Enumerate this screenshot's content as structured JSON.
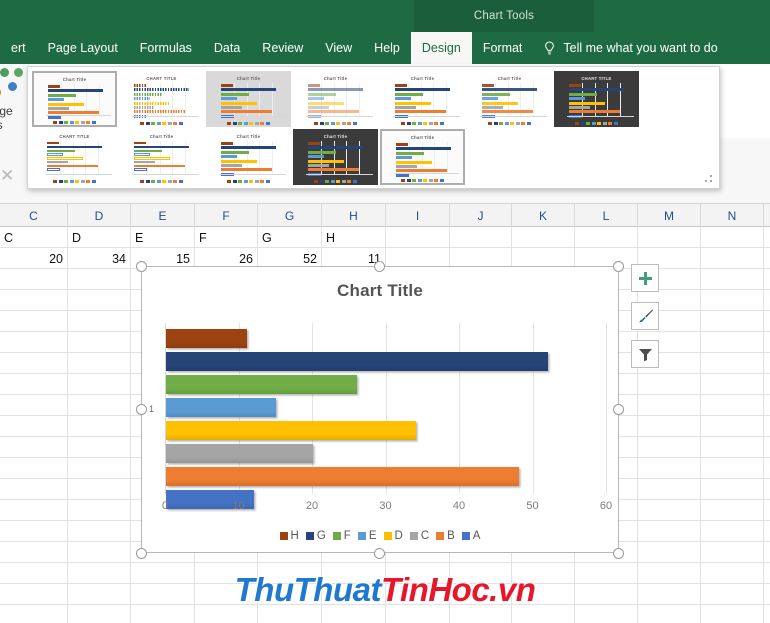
{
  "ribbon": {
    "contextual_title": "Chart Tools",
    "tabs": [
      {
        "label": "ert",
        "active": false
      },
      {
        "label": "Page Layout",
        "active": false
      },
      {
        "label": "Formulas",
        "active": false
      },
      {
        "label": "Data",
        "active": false
      },
      {
        "label": "Review",
        "active": false
      },
      {
        "label": "View",
        "active": false
      },
      {
        "label": "Help",
        "active": false
      },
      {
        "label": "Design",
        "active": true
      },
      {
        "label": "Format",
        "active": false
      }
    ],
    "tell_me": "Tell me what you want to do",
    "tell_me_icon": "lightbulb-icon",
    "change_colors_label_line1": "ange",
    "change_colors_label_line2": "ors",
    "change_colors_icon": "color-dots-icon"
  },
  "gallery": {
    "name": "chart-styles-gallery",
    "resize_grip_icon": "resize-grip-icon",
    "thumbnails": [
      {
        "title": "Chart Title",
        "selected": true,
        "variant": "plain"
      },
      {
        "title": "CHART TITLE",
        "selected": false,
        "variant": "dotted"
      },
      {
        "title": "Chart Title",
        "selected": false,
        "variant": "gray"
      },
      {
        "title": "Chart Title",
        "selected": false,
        "variant": "pastel"
      },
      {
        "title": "Chart Title",
        "selected": false,
        "variant": "plain"
      },
      {
        "title": "Chart Title",
        "selected": false,
        "variant": "hatched"
      },
      {
        "title": "CHART TITLE",
        "selected": false,
        "variant": "dark"
      },
      {
        "title": "CHART TITLE",
        "selected": false,
        "variant": "outline"
      },
      {
        "title": "Chart Title",
        "selected": false,
        "variant": "outline2"
      },
      {
        "title": "Chart Title",
        "selected": false,
        "variant": "plain"
      },
      {
        "title": "Chart Title",
        "selected": false,
        "variant": "dark"
      },
      {
        "title": "Chart Title",
        "selected": true,
        "variant": "plain"
      }
    ]
  },
  "sheet": {
    "column_headers": [
      "C",
      "D",
      "E",
      "F",
      "G",
      "H",
      "I",
      "J",
      "K",
      "L",
      "M",
      "N"
    ],
    "label_row": [
      "C",
      "D",
      "E",
      "F",
      "G",
      "H",
      "",
      "",
      "",
      "",
      "",
      ""
    ],
    "value_row": [
      "20",
      "34",
      "15",
      "26",
      "52",
      "11",
      "",
      "",
      "",
      "",
      "",
      ""
    ]
  },
  "chart": {
    "title": "Chart Title",
    "category_axis_label": "1",
    "elements_button_icon": "plus-icon",
    "styles_button_icon": "paintbrush-icon",
    "filters_button_icon": "funnel-icon"
  },
  "chart_data": {
    "type": "bar",
    "title": "Chart Title",
    "xlabel": "",
    "ylabel": "",
    "categories": [
      "1"
    ],
    "orientation": "horizontal",
    "xlim": [
      0,
      60
    ],
    "xticks": [
      0,
      10,
      20,
      30,
      40,
      50,
      60
    ],
    "grid": true,
    "legend_position": "bottom",
    "series": [
      {
        "name": "H",
        "values": [
          11
        ],
        "color": "#9c4312"
      },
      {
        "name": "G",
        "values": [
          52
        ],
        "color": "#264478"
      },
      {
        "name": "F",
        "values": [
          26
        ],
        "color": "#70ad47"
      },
      {
        "name": "E",
        "values": [
          15
        ],
        "color": "#5b9bd5"
      },
      {
        "name": "D",
        "values": [
          34
        ],
        "color": "#ffc000"
      },
      {
        "name": "C",
        "values": [
          20
        ],
        "color": "#a5a5a5"
      },
      {
        "name": "B",
        "values": [
          48
        ],
        "color": "#ed7d31"
      },
      {
        "name": "A",
        "values": [
          12
        ],
        "color": "#4472c4"
      }
    ]
  },
  "watermark": {
    "part1": "ThuThuat",
    "part2": "TinHoc.vn"
  }
}
